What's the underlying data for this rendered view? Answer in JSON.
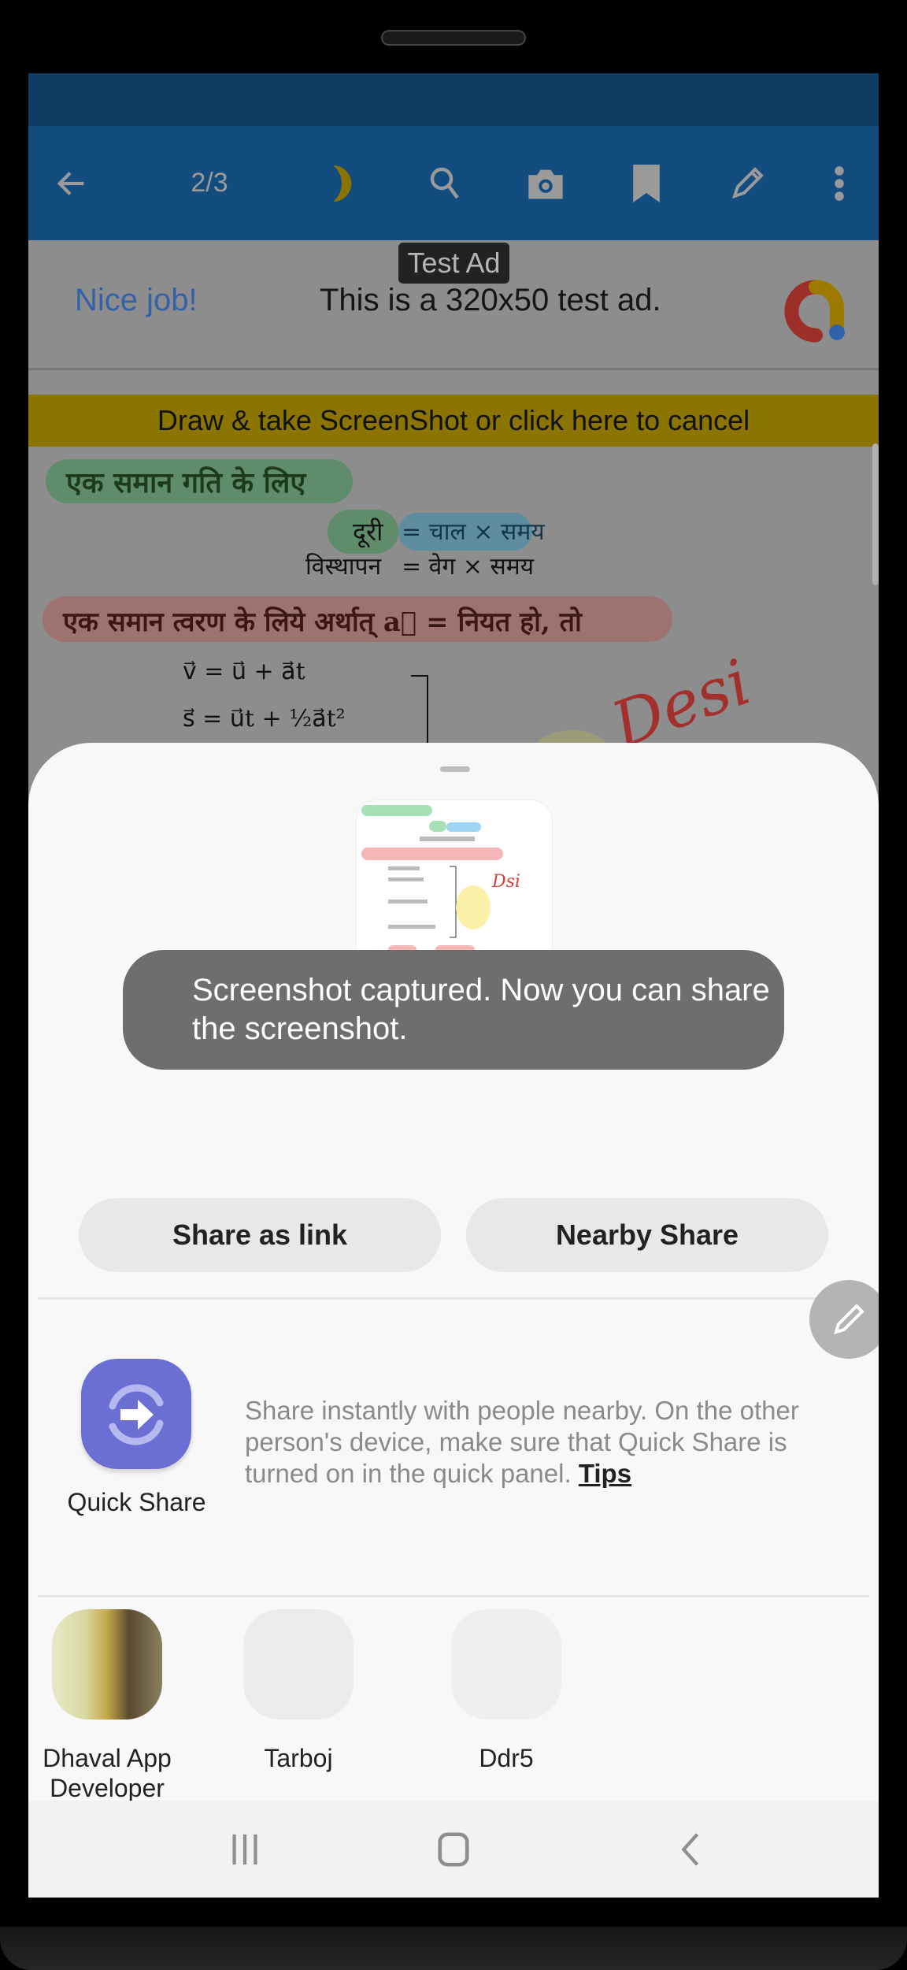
{
  "toolbar": {
    "back_icon": "arrow-left-icon",
    "page_indicator": "2/3",
    "icons": [
      "night-mode-moon-icon",
      "search-icon",
      "camera-icon",
      "bookmark-icon",
      "pencil-icon",
      "more-vert-icon"
    ]
  },
  "ad": {
    "badge": "Test Ad",
    "headline": "Nice job!",
    "body": "This is a 320x50 test ad.",
    "logo_icon": "admob-logo-icon",
    "colors": {
      "red": "#c4302b",
      "yellow": "#c89a00",
      "blue": "#3b78d8"
    }
  },
  "banner": {
    "text": "Draw & take ScreenShot or click here to cancel",
    "color": "#8c7400"
  },
  "document": {
    "heading1": "एक समान गति के लिए",
    "eq1_left": "दूरी",
    "eq1_right": "= चाल × समय",
    "eq2_left": "विस्थापन",
    "eq2_right": "= वेग × समय",
    "heading2": "एक समान त्वरण के लिये अर्थात् a⃗ = नियत हो, तो",
    "formula1": "v⃗ = u⃗ + a⃗t",
    "formula2": "s⃗ = u⃗t + ½a⃗t²",
    "signature": "Desi"
  },
  "share_sheet": {
    "preview_label": "screenshot-preview",
    "buttons": {
      "share_as_link": "Share as link",
      "nearby_share": "Nearby Share"
    },
    "edit_icon": "pencil-icon",
    "quick_share": {
      "label": "Quick Share",
      "description": "Share instantly with people nearby. On the other person's device, make sure that Quick Share is turned on in the quick panel.",
      "tips_link": "Tips",
      "color": "#6b6fd4"
    },
    "contacts": [
      {
        "name": "Dhaval App Developer"
      },
      {
        "name": "Tarboj"
      },
      {
        "name": "Ddr5"
      }
    ],
    "apps": [
      {
        "icon": "whatsapp-icon",
        "color": "#3ddc5c"
      },
      {
        "icon": "messages-icon",
        "color": "#0a9cf0"
      },
      {
        "icon": "app-icon",
        "color": "#e8602f"
      },
      {
        "icon": "app-icon",
        "color": "#e8602f"
      }
    ]
  },
  "toast": {
    "text": "Screenshot captured. Now you can share the screenshot."
  },
  "navbar": {
    "recents": "recents-icon",
    "home": "home-icon",
    "back": "back-icon"
  }
}
